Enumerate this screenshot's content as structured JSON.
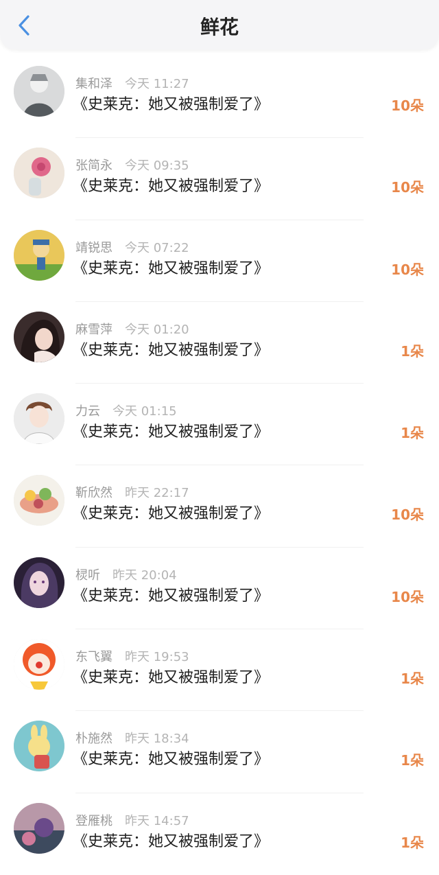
{
  "header": {
    "title": "鲜花"
  },
  "colors": {
    "accent": "#e8874a",
    "back": "#4a90e2"
  },
  "items": [
    {
      "user": "集和泽",
      "time": "今天 11:27",
      "book": "《史莱克：她又被强制爱了》",
      "amount": "10朵"
    },
    {
      "user": "张简永",
      "time": "今天 09:35",
      "book": "《史莱克：她又被强制爱了》",
      "amount": "10朵"
    },
    {
      "user": "靖锐思",
      "time": "今天 07:22",
      "book": "《史莱克：她又被强制爱了》",
      "amount": "10朵"
    },
    {
      "user": "麻雪萍",
      "time": "今天 01:20",
      "book": "《史莱克：她又被强制爱了》",
      "amount": "1朵"
    },
    {
      "user": "力云",
      "time": "今天 01:15",
      "book": "《史莱克：她又被强制爱了》",
      "amount": "1朵"
    },
    {
      "user": "靳欣然",
      "time": "昨天 22:17",
      "book": "《史莱克：她又被强制爱了》",
      "amount": "10朵"
    },
    {
      "user": "棂听",
      "time": "昨天 20:04",
      "book": "《史莱克：她又被强制爱了》",
      "amount": "10朵"
    },
    {
      "user": "东飞翼",
      "time": "昨天 19:53",
      "book": "《史莱克：她又被强制爱了》",
      "amount": "1朵"
    },
    {
      "user": "朴施然",
      "time": "昨天 18:34",
      "book": "《史莱克：她又被强制爱了》",
      "amount": "1朵"
    },
    {
      "user": "登雁桃",
      "time": "昨天 14:57",
      "book": "《史莱克：她又被强制爱了》",
      "amount": "1朵"
    }
  ]
}
